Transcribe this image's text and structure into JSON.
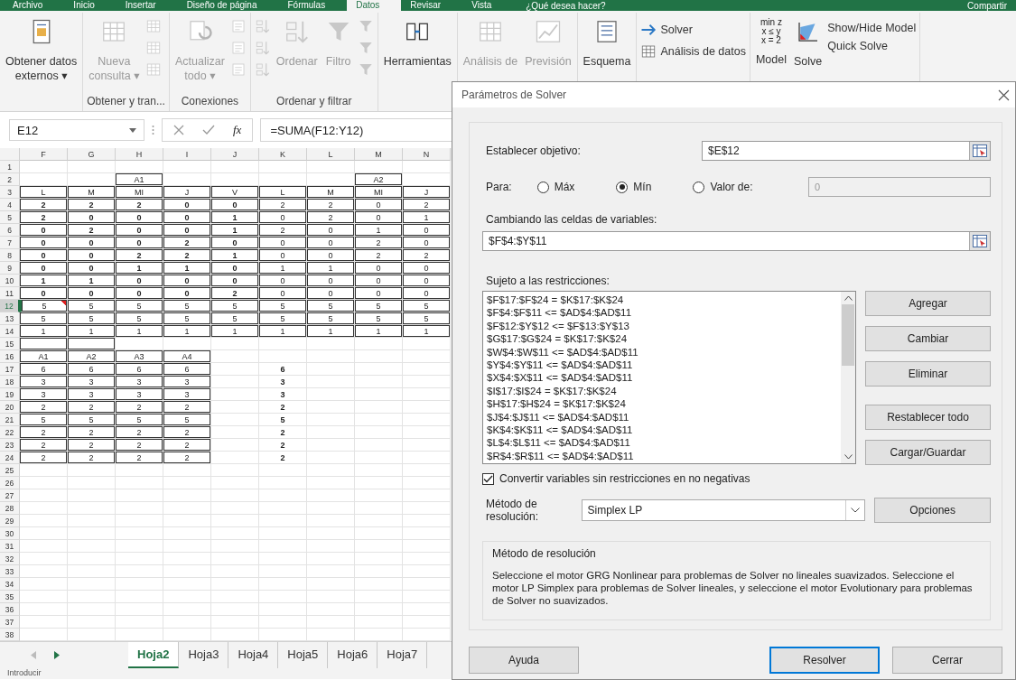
{
  "ribbon": {
    "tabs": [
      {
        "label": "Archivo",
        "selected": false
      },
      {
        "label": "Inicio",
        "selected": false
      },
      {
        "label": "Insertar",
        "selected": false
      },
      {
        "label": "Diseño de página",
        "selected": false
      },
      {
        "label": "Fórmulas",
        "selected": false
      },
      {
        "label": "Datos",
        "selected": true
      },
      {
        "label": "Revisar",
        "selected": false
      },
      {
        "label": "Vista",
        "selected": false
      }
    ],
    "tell_me": "¿Qué desea hacer?",
    "share": "Compartir",
    "groups": [
      {
        "items": [
          {
            "kind": "large",
            "lines": [
              "Obtener datos",
              "externos ▾"
            ],
            "disabled": false
          }
        ]
      },
      {
        "label": "Obtener y tran...",
        "items": [
          {
            "kind": "large",
            "lines": [
              "Nueva",
              "consulta ▾"
            ],
            "disabled": true
          },
          {
            "kind": "iconstack",
            "disabled": true
          }
        ]
      },
      {
        "label": "Conexiones",
        "items": [
          {
            "kind": "large",
            "lines": [
              "Actualizar",
              "todo ▾"
            ],
            "disabled": true
          },
          {
            "kind": "iconstack",
            "disabled": true
          }
        ]
      },
      {
        "label": "Ordenar y filtrar",
        "items": [
          {
            "kind": "iconstack",
            "disabled": true
          },
          {
            "kind": "large",
            "lines": [
              "Ordenar"
            ],
            "disabled": true
          },
          {
            "kind": "large",
            "lines": [
              "Filtro"
            ],
            "disabled": true
          },
          {
            "kind": "iconstack",
            "disabled": true
          }
        ]
      },
      {
        "items": [
          {
            "kind": "large",
            "lines": [
              "Herramientas"
            ],
            "disabled": false
          }
        ]
      },
      {
        "items": [
          {
            "kind": "large",
            "lines": [
              "Análisis de"
            ],
            "disabled": true
          },
          {
            "kind": "large",
            "lines": [
              "Previsión"
            ],
            "disabled": true
          }
        ]
      },
      {
        "items": [
          {
            "kind": "large",
            "lines": [
              "Esquema"
            ],
            "disabled": false
          }
        ]
      },
      {
        "items": [
          {
            "kind": "stack",
            "entries": [
              "Solver",
              "Análisis de datos"
            ],
            "disabled": false
          }
        ]
      },
      {
        "items": [
          {
            "kind": "formula",
            "formula": [
              "min z",
              "x ≤ y",
              "x = 2"
            ],
            "lines": [
              "Model"
            ],
            "disabled": false
          },
          {
            "kind": "large",
            "lines": [
              "Solve"
            ],
            "disabled": false
          },
          {
            "kind": "stack",
            "entries": [
              "Show/Hide Model",
              "Quick Solve"
            ],
            "disabled": false
          }
        ]
      }
    ]
  },
  "sheet": {
    "name_box": "E12",
    "fx": "fx",
    "formula": "=SUMA(F12:Y12)",
    "columns": [
      "F",
      "G",
      "H",
      "I",
      "J",
      "K",
      "L",
      "M",
      "N"
    ],
    "rows": [
      {
        "n": "1",
        "selected": false
      },
      {
        "n": "2",
        "selected": false,
        "cells": [
          null,
          null,
          {
            "text": "A1",
            "bold": false,
            "boxed": true
          },
          null,
          null,
          null,
          null,
          {
            "text": "A2",
            "bold": false,
            "boxed": true
          },
          null
        ]
      },
      {
        "n": "3",
        "selected": false,
        "cells": [
          {
            "text": "L",
            "bold": false,
            "boxed": true
          },
          {
            "text": "M",
            "bold": false,
            "boxed": true
          },
          {
            "text": "MI",
            "bold": false,
            "boxed": true
          },
          {
            "text": "J",
            "bold": false,
            "boxed": true
          },
          {
            "text": "V",
            "bold": false,
            "boxed": true
          },
          {
            "text": "L",
            "bold": false,
            "boxed": true
          },
          {
            "text": "M",
            "bold": false,
            "boxed": true
          },
          {
            "text": "MI",
            "bold": false,
            "boxed": true
          },
          {
            "text": "J",
            "bold": false,
            "boxed": true
          }
        ]
      },
      {
        "n": "4",
        "selected": false,
        "cells": [
          {
            "text": "2",
            "bold": true,
            "boxed": true
          },
          {
            "text": "2",
            "bold": true,
            "boxed": true
          },
          {
            "text": "2",
            "bold": true,
            "boxed": true
          },
          {
            "text": "0",
            "bold": true,
            "boxed": true
          },
          {
            "text": "0",
            "bold": true,
            "boxed": true
          },
          {
            "text": "2",
            "bold": false,
            "boxed": true
          },
          {
            "text": "2",
            "bold": false,
            "boxed": true
          },
          {
            "text": "0",
            "bold": false,
            "boxed": true
          },
          {
            "text": "2",
            "bold": false,
            "boxed": true
          }
        ]
      },
      {
        "n": "5",
        "selected": false,
        "cells": [
          {
            "text": "2",
            "bold": true,
            "boxed": true
          },
          {
            "text": "0",
            "bold": true,
            "boxed": true
          },
          {
            "text": "0",
            "bold": true,
            "boxed": true
          },
          {
            "text": "0",
            "bold": true,
            "boxed": true
          },
          {
            "text": "1",
            "bold": true,
            "boxed": true
          },
          {
            "text": "0",
            "bold": false,
            "boxed": true
          },
          {
            "text": "2",
            "bold": false,
            "boxed": true
          },
          {
            "text": "0",
            "bold": false,
            "boxed": true
          },
          {
            "text": "1",
            "bold": false,
            "boxed": true
          }
        ]
      },
      {
        "n": "6",
        "selected": false,
        "cells": [
          {
            "text": "0",
            "bold": true,
            "boxed": true
          },
          {
            "text": "2",
            "bold": true,
            "boxed": true
          },
          {
            "text": "0",
            "bold": true,
            "boxed": true
          },
          {
            "text": "0",
            "bold": true,
            "boxed": true
          },
          {
            "text": "1",
            "bold": true,
            "boxed": true
          },
          {
            "text": "2",
            "bold": false,
            "boxed": true
          },
          {
            "text": "0",
            "bold": false,
            "boxed": true
          },
          {
            "text": "1",
            "bold": false,
            "boxed": true
          },
          {
            "text": "0",
            "bold": false,
            "boxed": true
          }
        ]
      },
      {
        "n": "7",
        "selected": false,
        "cells": [
          {
            "text": "0",
            "bold": true,
            "boxed": true
          },
          {
            "text": "0",
            "bold": true,
            "boxed": true
          },
          {
            "text": "0",
            "bold": true,
            "boxed": true
          },
          {
            "text": "2",
            "bold": true,
            "boxed": true
          },
          {
            "text": "0",
            "bold": true,
            "boxed": true
          },
          {
            "text": "0",
            "bold": false,
            "boxed": true
          },
          {
            "text": "0",
            "bold": false,
            "boxed": true
          },
          {
            "text": "2",
            "bold": false,
            "boxed": true
          },
          {
            "text": "0",
            "bold": false,
            "boxed": true
          }
        ]
      },
      {
        "n": "8",
        "selected": false,
        "cells": [
          {
            "text": "0",
            "bold": true,
            "boxed": true
          },
          {
            "text": "0",
            "bold": true,
            "boxed": true
          },
          {
            "text": "2",
            "bold": true,
            "boxed": true
          },
          {
            "text": "2",
            "bold": true,
            "boxed": true
          },
          {
            "text": "1",
            "bold": true,
            "boxed": true
          },
          {
            "text": "0",
            "bold": false,
            "boxed": true
          },
          {
            "text": "0",
            "bold": false,
            "boxed": true
          },
          {
            "text": "2",
            "bold": false,
            "boxed": true
          },
          {
            "text": "2",
            "bold": false,
            "boxed": true
          }
        ]
      },
      {
        "n": "9",
        "selected": false,
        "cells": [
          {
            "text": "0",
            "bold": true,
            "boxed": true
          },
          {
            "text": "0",
            "bold": true,
            "boxed": true
          },
          {
            "text": "1",
            "bold": true,
            "boxed": true
          },
          {
            "text": "1",
            "bold": true,
            "boxed": true
          },
          {
            "text": "0",
            "bold": true,
            "boxed": true
          },
          {
            "text": "1",
            "bold": false,
            "boxed": true
          },
          {
            "text": "1",
            "bold": false,
            "boxed": true
          },
          {
            "text": "0",
            "bold": false,
            "boxed": true
          },
          {
            "text": "0",
            "bold": false,
            "boxed": true
          }
        ]
      },
      {
        "n": "10",
        "selected": false,
        "cells": [
          {
            "text": "1",
            "bold": true,
            "boxed": true
          },
          {
            "text": "1",
            "bold": true,
            "boxed": true
          },
          {
            "text": "0",
            "bold": true,
            "boxed": true
          },
          {
            "text": "0",
            "bold": true,
            "boxed": true
          },
          {
            "text": "0",
            "bold": true,
            "boxed": true
          },
          {
            "text": "0",
            "bold": false,
            "boxed": true
          },
          {
            "text": "0",
            "bold": false,
            "boxed": true
          },
          {
            "text": "0",
            "bold": false,
            "boxed": true
          },
          {
            "text": "0",
            "bold": false,
            "boxed": true
          }
        ]
      },
      {
        "n": "11",
        "selected": false,
        "cells": [
          {
            "text": "0",
            "bold": true,
            "boxed": true
          },
          {
            "text": "0",
            "bold": true,
            "boxed": true
          },
          {
            "text": "0",
            "bold": true,
            "boxed": true
          },
          {
            "text": "0",
            "bold": true,
            "boxed": true
          },
          {
            "text": "2",
            "bold": true,
            "boxed": true
          },
          {
            "text": "0",
            "bold": false,
            "boxed": true
          },
          {
            "text": "0",
            "bold": false,
            "boxed": true
          },
          {
            "text": "0",
            "bold": false,
            "boxed": true
          },
          {
            "text": "0",
            "bold": false,
            "boxed": true
          }
        ]
      },
      {
        "n": "12",
        "selected": true,
        "cells": [
          {
            "text": "5",
            "bold": false,
            "boxed": true,
            "comment": true
          },
          {
            "text": "5",
            "bold": false,
            "boxed": true
          },
          {
            "text": "5",
            "bold": false,
            "boxed": true
          },
          {
            "text": "5",
            "bold": false,
            "boxed": true
          },
          {
            "text": "5",
            "bold": false,
            "boxed": true
          },
          {
            "text": "5",
            "bold": false,
            "boxed": true
          },
          {
            "text": "5",
            "bold": false,
            "boxed": true
          },
          {
            "text": "5",
            "bold": false,
            "boxed": true
          },
          {
            "text": "5",
            "bold": false,
            "boxed": true
          }
        ]
      },
      {
        "n": "13",
        "selected": false,
        "cells": [
          {
            "text": "5",
            "bold": false,
            "boxed": true
          },
          {
            "text": "5",
            "bold": false,
            "boxed": true
          },
          {
            "text": "5",
            "bold": false,
            "boxed": true
          },
          {
            "text": "5",
            "bold": false,
            "boxed": true
          },
          {
            "text": "5",
            "bold": false,
            "boxed": true
          },
          {
            "text": "5",
            "bold": false,
            "boxed": true
          },
          {
            "text": "5",
            "bold": false,
            "boxed": true
          },
          {
            "text": "5",
            "bold": false,
            "boxed": true
          },
          {
            "text": "5",
            "bold": false,
            "boxed": true
          }
        ]
      },
      {
        "n": "14",
        "selected": false,
        "cells": [
          {
            "text": "1",
            "bold": false,
            "boxed": true
          },
          {
            "text": "1",
            "bold": false,
            "boxed": true
          },
          {
            "text": "1",
            "bold": false,
            "boxed": true
          },
          {
            "text": "1",
            "bold": false,
            "boxed": true
          },
          {
            "text": "1",
            "bold": false,
            "boxed": true
          },
          {
            "text": "1",
            "bold": false,
            "boxed": true
          },
          {
            "text": "1",
            "bold": false,
            "boxed": true
          },
          {
            "text": "1",
            "bold": false,
            "boxed": true
          },
          {
            "text": "1",
            "bold": false,
            "boxed": true
          }
        ]
      },
      {
        "n": "15",
        "selected": false,
        "cells": [
          {
            "boxed": true
          },
          {
            "boxed": true
          },
          null,
          null,
          null,
          null,
          null,
          null,
          null
        ]
      },
      {
        "n": "16",
        "selected": false,
        "cells": [
          {
            "text": "A1",
            "bold": false,
            "boxed": true
          },
          {
            "text": "A2",
            "bold": false,
            "boxed": true
          },
          {
            "text": "A3",
            "bold": false,
            "boxed": true
          },
          {
            "text": "A4",
            "bold": false,
            "boxed": true
          },
          null,
          null,
          null,
          null,
          null
        ]
      },
      {
        "n": "17",
        "selected": false,
        "cells": [
          {
            "text": "6",
            "bold": false,
            "boxed": true
          },
          {
            "text": "6",
            "bold": false,
            "boxed": true
          },
          {
            "text": "6",
            "bold": false,
            "boxed": true
          },
          {
            "text": "6",
            "bold": false,
            "boxed": true
          },
          null,
          {
            "text": "6",
            "bold": true,
            "boxed": false
          },
          null,
          null,
          null
        ]
      },
      {
        "n": "18",
        "selected": false,
        "cells": [
          {
            "text": "3",
            "bold": false,
            "boxed": true
          },
          {
            "text": "3",
            "bold": false,
            "boxed": true
          },
          {
            "text": "3",
            "bold": false,
            "boxed": true
          },
          {
            "text": "3",
            "bold": false,
            "boxed": true
          },
          null,
          {
            "text": "3",
            "bold": true,
            "boxed": false
          },
          null,
          null,
          null
        ]
      },
      {
        "n": "19",
        "selected": false,
        "cells": [
          {
            "text": "3",
            "bold": false,
            "boxed": true
          },
          {
            "text": "3",
            "bold": false,
            "boxed": true
          },
          {
            "text": "3",
            "bold": false,
            "boxed": true
          },
          {
            "text": "3",
            "bold": false,
            "boxed": true
          },
          null,
          {
            "text": "3",
            "bold": true,
            "boxed": false
          },
          null,
          null,
          null
        ]
      },
      {
        "n": "20",
        "selected": false,
        "cells": [
          {
            "text": "2",
            "bold": false,
            "boxed": true
          },
          {
            "text": "2",
            "bold": false,
            "boxed": true
          },
          {
            "text": "2",
            "bold": false,
            "boxed": true
          },
          {
            "text": "2",
            "bold": false,
            "boxed": true
          },
          null,
          {
            "text": "2",
            "bold": true,
            "boxed": false
          },
          null,
          null,
          null
        ]
      },
      {
        "n": "21",
        "selected": false,
        "cells": [
          {
            "text": "5",
            "bold": false,
            "boxed": true
          },
          {
            "text": "5",
            "bold": false,
            "boxed": true
          },
          {
            "text": "5",
            "bold": false,
            "boxed": true
          },
          {
            "text": "5",
            "bold": false,
            "boxed": true
          },
          null,
          {
            "text": "5",
            "bold": true,
            "boxed": false
          },
          null,
          null,
          null
        ]
      },
      {
        "n": "22",
        "selected": false,
        "cells": [
          {
            "text": "2",
            "bold": false,
            "boxed": true
          },
          {
            "text": "2",
            "bold": false,
            "boxed": true
          },
          {
            "text": "2",
            "bold": false,
            "boxed": true
          },
          {
            "text": "2",
            "bold": false,
            "boxed": true
          },
          null,
          {
            "text": "2",
            "bold": true,
            "boxed": false
          },
          null,
          null,
          null
        ]
      },
      {
        "n": "23",
        "selected": false,
        "cells": [
          {
            "text": "2",
            "bold": false,
            "boxed": true
          },
          {
            "text": "2",
            "bold": false,
            "boxed": true
          },
          {
            "text": "2",
            "bold": false,
            "boxed": true
          },
          {
            "text": "2",
            "bold": false,
            "boxed": true
          },
          null,
          {
            "text": "2",
            "bold": true,
            "boxed": false
          },
          null,
          null,
          null
        ]
      },
      {
        "n": "24",
        "selected": false,
        "cells": [
          {
            "text": "2",
            "bold": false,
            "boxed": true
          },
          {
            "text": "2",
            "bold": false,
            "boxed": true
          },
          {
            "text": "2",
            "bold": false,
            "boxed": true
          },
          {
            "text": "2",
            "bold": false,
            "boxed": true
          },
          null,
          {
            "text": "2",
            "bold": true,
            "boxed": false
          },
          null,
          null,
          null
        ]
      },
      {
        "n": "25",
        "selected": false
      },
      {
        "n": "26",
        "selected": false
      },
      {
        "n": "27",
        "selected": false
      },
      {
        "n": "28",
        "selected": false
      },
      {
        "n": "29",
        "selected": false
      },
      {
        "n": "30",
        "selected": false
      },
      {
        "n": "31",
        "selected": false
      },
      {
        "n": "32",
        "selected": false
      },
      {
        "n": "33",
        "selected": false
      },
      {
        "n": "34",
        "selected": false
      },
      {
        "n": "35",
        "selected": false
      },
      {
        "n": "36",
        "selected": false
      },
      {
        "n": "37",
        "selected": false
      },
      {
        "n": "38",
        "selected": false
      }
    ],
    "tabs": [
      {
        "label": "Hoja2",
        "selected": true
      },
      {
        "label": "Hoja3",
        "selected": false
      },
      {
        "label": "Hoja4",
        "selected": false
      },
      {
        "label": "Hoja5",
        "selected": false
      },
      {
        "label": "Hoja6",
        "selected": false
      },
      {
        "label": "Hoja7",
        "selected": false
      }
    ],
    "status": "Introducir"
  },
  "solver_dialog": {
    "title": "Parámetros de Solver",
    "objective_label": "Establecer objetivo:",
    "objective": "$E$12",
    "to_label": "Para:",
    "options": [
      {
        "label": "Máx",
        "selected": false
      },
      {
        "label": "Mín",
        "selected": true
      },
      {
        "label": "Valor de:",
        "selected": false
      }
    ],
    "value_field": {
      "value": "0",
      "disabled": true
    },
    "variables_label": "Cambiando las celdas de variables:",
    "variables": "$F$4:$Y$11",
    "constraints_label": "Sujeto a las restricciones:",
    "constraints": [
      "$F$17:$F$24 = $K$17:$K$24",
      "$F$4:$F$11 <= $AD$4:$AD$11",
      "$F$12:$Y$12 <= $F$13:$Y$13",
      "$G$17:$G$24 = $K$17:$K$24",
      "$W$4:$W$11 <= $AD$4:$AD$11",
      "$Y$4:$Y$11 <= $AD$4:$AD$11",
      "$X$4:$X$11 <= $AD$4:$AD$11",
      "$I$17:$I$24 = $K$17:$K$24",
      "$H$17:$H$24 = $K$17:$K$24",
      "$J$4:$J$11 <= $AD$4:$AD$11",
      "$K$4:$K$11 <= $AD$4:$AD$11",
      "$L$4:$L$11 <= $AD$4:$AD$11",
      "$R$4:$R$11 <= $AD$4:$AD$11"
    ],
    "constraint_buttons": [
      "Agregar",
      "Cambiar",
      "Eliminar",
      "Restablecer todo",
      "Cargar/Guardar"
    ],
    "nonnegative": {
      "label": "Convertir variables sin restricciones en no negativas",
      "checked": true
    },
    "method_label": "Método de resolución:",
    "method": "Simplex LP",
    "options_button": "Opciones",
    "method_box": {
      "title": "Método de resolución",
      "text": "Seleccione el motor GRG Nonlinear para problemas de Solver no lineales suavizados. Seleccione el motor LP Simplex para problemas de Solver lineales, y seleccione el motor Evolutionary para problemas de Solver no suavizados."
    },
    "buttons": [
      {
        "label": "Ayuda",
        "focused": false
      },
      {
        "label": "Resolver",
        "focused": true
      },
      {
        "label": "Cerrar",
        "focused": false
      }
    ]
  }
}
